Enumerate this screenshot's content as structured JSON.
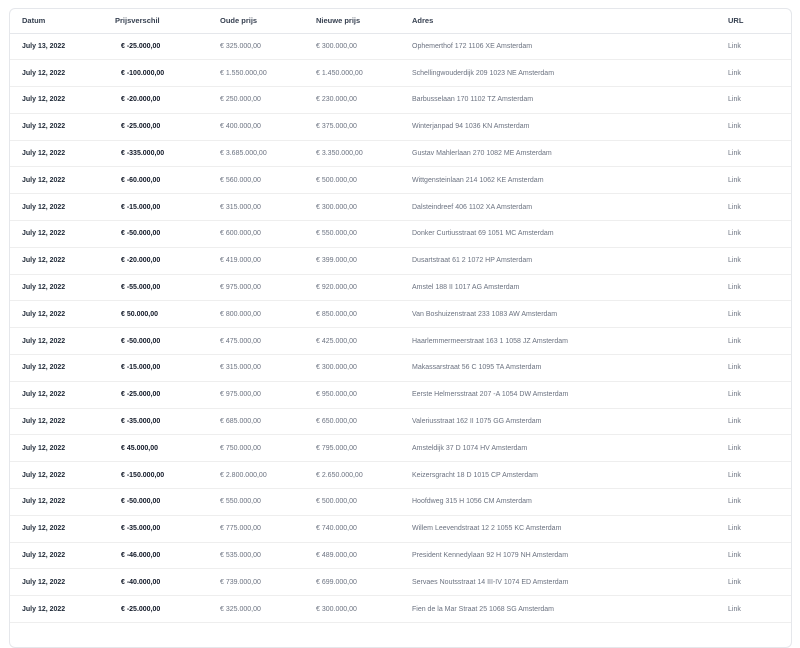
{
  "table": {
    "headers": {
      "date": "Datum",
      "diff": "Prijsverschil",
      "old": "Oude prijs",
      "new": "Nieuwe prijs",
      "address": "Adres",
      "url": "URL"
    },
    "rows": [
      {
        "date": "July 13, 2022",
        "diff": "€ -25.000,00",
        "old": "€ 325.000,00",
        "new": "€ 300.000,00",
        "address": "Ophemerthof 172 1106 XE Amsterdam",
        "url": "Link"
      },
      {
        "date": "July 12, 2022",
        "diff": "€ -100.000,00",
        "old": "€ 1.550.000,00",
        "new": "€ 1.450.000,00",
        "address": "Schellingwouderdijk 209 1023 NE Amsterdam",
        "url": "Link"
      },
      {
        "date": "July 12, 2022",
        "diff": "€ -20.000,00",
        "old": "€ 250.000,00",
        "new": "€ 230.000,00",
        "address": "Barbusselaan 170 1102 TZ Amsterdam",
        "url": "Link"
      },
      {
        "date": "July 12, 2022",
        "diff": "€ -25.000,00",
        "old": "€ 400.000,00",
        "new": "€ 375.000,00",
        "address": "Winterjanpad 94 1036 KN Amsterdam",
        "url": "Link"
      },
      {
        "date": "July 12, 2022",
        "diff": "€ -335.000,00",
        "old": "€ 3.685.000,00",
        "new": "€ 3.350.000,00",
        "address": "Gustav Mahlerlaan 270 1082 ME Amsterdam",
        "url": "Link"
      },
      {
        "date": "July 12, 2022",
        "diff": "€ -60.000,00",
        "old": "€ 560.000,00",
        "new": "€ 500.000,00",
        "address": "Wittgensteinlaan 214 1062 KE Amsterdam",
        "url": "Link"
      },
      {
        "date": "July 12, 2022",
        "diff": "€ -15.000,00",
        "old": "€ 315.000,00",
        "new": "€ 300.000,00",
        "address": "Dalsteindreef 406 1102 XA Amsterdam",
        "url": "Link"
      },
      {
        "date": "July 12, 2022",
        "diff": "€ -50.000,00",
        "old": "€ 600.000,00",
        "new": "€ 550.000,00",
        "address": "Donker Curtiusstraat 69 1051 MC Amsterdam",
        "url": "Link"
      },
      {
        "date": "July 12, 2022",
        "diff": "€ -20.000,00",
        "old": "€ 419.000,00",
        "new": "€ 399.000,00",
        "address": "Dusartstraat 61 2 1072 HP Amsterdam",
        "url": "Link"
      },
      {
        "date": "July 12, 2022",
        "diff": "€ -55.000,00",
        "old": "€ 975.000,00",
        "new": "€ 920.000,00",
        "address": "Amstel 188 II 1017 AG Amsterdam",
        "url": "Link"
      },
      {
        "date": "July 12, 2022",
        "diff": "€ 50.000,00",
        "old": "€ 800.000,00",
        "new": "€ 850.000,00",
        "address": "Van Boshuizenstraat 233 1083 AW Amsterdam",
        "url": "Link"
      },
      {
        "date": "July 12, 2022",
        "diff": "€ -50.000,00",
        "old": "€ 475.000,00",
        "new": "€ 425.000,00",
        "address": "Haarlemmermeerstraat 163 1 1058 JZ Amsterdam",
        "url": "Link"
      },
      {
        "date": "July 12, 2022",
        "diff": "€ -15.000,00",
        "old": "€ 315.000,00",
        "new": "€ 300.000,00",
        "address": "Makassarstraat 56 C 1095 TA Amsterdam",
        "url": "Link"
      },
      {
        "date": "July 12, 2022",
        "diff": "€ -25.000,00",
        "old": "€ 975.000,00",
        "new": "€ 950.000,00",
        "address": "Eerste Helmersstraat 207 -A 1054 DW Amsterdam",
        "url": "Link"
      },
      {
        "date": "July 12, 2022",
        "diff": "€ -35.000,00",
        "old": "€ 685.000,00",
        "new": "€ 650.000,00",
        "address": "Valeriusstraat 162 II 1075 GG Amsterdam",
        "url": "Link"
      },
      {
        "date": "July 12, 2022",
        "diff": "€ 45.000,00",
        "old": "€ 750.000,00",
        "new": "€ 795.000,00",
        "address": "Amsteldijk 37 D 1074 HV Amsterdam",
        "url": "Link"
      },
      {
        "date": "July 12, 2022",
        "diff": "€ -150.000,00",
        "old": "€ 2.800.000,00",
        "new": "€ 2.650.000,00",
        "address": "Keizersgracht 18 D 1015 CP Amsterdam",
        "url": "Link"
      },
      {
        "date": "July 12, 2022",
        "diff": "€ -50.000,00",
        "old": "€ 550.000,00",
        "new": "€ 500.000,00",
        "address": "Hoofdweg 315 H 1056 CM Amsterdam",
        "url": "Link"
      },
      {
        "date": "July 12, 2022",
        "diff": "€ -35.000,00",
        "old": "€ 775.000,00",
        "new": "€ 740.000,00",
        "address": "Willem Leevendstraat 12 2 1055 KC Amsterdam",
        "url": "Link"
      },
      {
        "date": "July 12, 2022",
        "diff": "€ -46.000,00",
        "old": "€ 535.000,00",
        "new": "€ 489.000,00",
        "address": "President Kennedylaan 92 H 1079 NH Amsterdam",
        "url": "Link"
      },
      {
        "date": "July 12, 2022",
        "diff": "€ -40.000,00",
        "old": "€ 739.000,00",
        "new": "€ 699.000,00",
        "address": "Servaes Noutsstraat 14 III-IV 1074 ED Amsterdam",
        "url": "Link"
      },
      {
        "date": "July 12, 2022",
        "diff": "€ -25.000,00",
        "old": "€ 325.000,00",
        "new": "€ 300.000,00",
        "address": "Fien de la Mar Straat 25 1068 SG Amsterdam",
        "url": "Link"
      }
    ]
  }
}
